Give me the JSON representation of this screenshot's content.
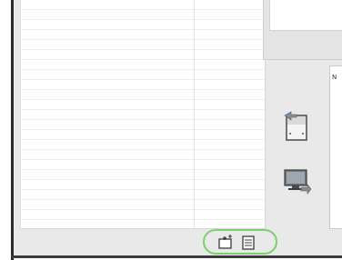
{
  "right_list": {
    "header_label": "N"
  },
  "icons": {
    "move_left": "file-transfer-left-icon",
    "move_right": "monitor-transfer-icon",
    "toolbar_new": "new-folder-icon",
    "toolbar_doc": "document-icon"
  },
  "colors": {
    "highlight": "#7ccf6b",
    "panel_bg": "#e9e9e9",
    "border_dark": "#2b2b2b"
  }
}
